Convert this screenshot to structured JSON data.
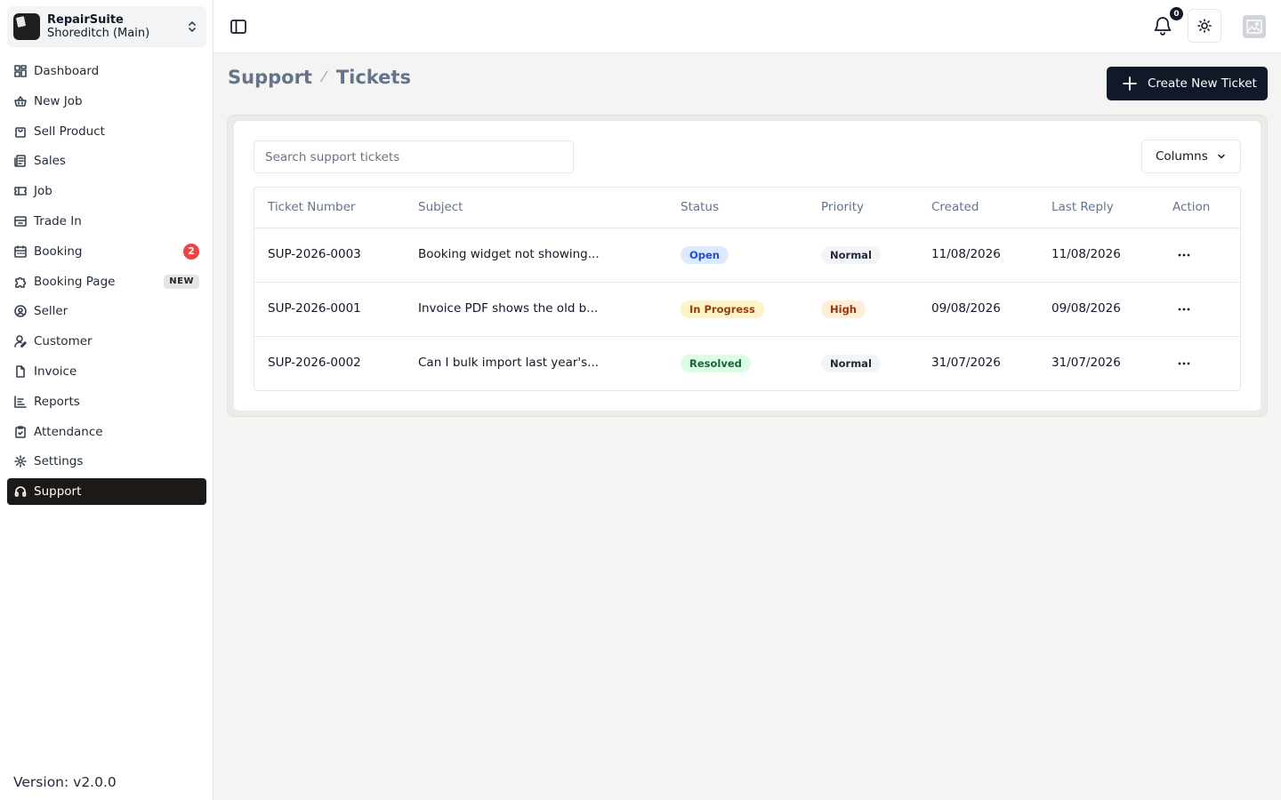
{
  "org": {
    "name": "RepairSuite",
    "branch": "Shoreditch (Main)"
  },
  "nav": [
    {
      "label": "Dashboard",
      "icon": "dashboard-icon"
    },
    {
      "label": "New Job",
      "icon": "basket-icon"
    },
    {
      "label": "Sell Product",
      "icon": "bag-icon"
    },
    {
      "label": "Sales",
      "icon": "receipt-icon"
    },
    {
      "label": "Job",
      "icon": "ticket-icon"
    },
    {
      "label": "Trade In",
      "icon": "archive-icon"
    },
    {
      "label": "Booking",
      "icon": "calendar-icon",
      "badge": "2"
    },
    {
      "label": "Booking Page",
      "icon": "puzzle-icon",
      "tag": "NEW"
    },
    {
      "label": "Seller",
      "icon": "at-icon"
    },
    {
      "label": "Customer",
      "icon": "user-pen-icon"
    },
    {
      "label": "Invoice",
      "icon": "file-icon"
    },
    {
      "label": "Reports",
      "icon": "chart-icon"
    },
    {
      "label": "Attendance",
      "icon": "clipboard-check-icon"
    },
    {
      "label": "Settings",
      "icon": "gear-icon"
    },
    {
      "label": "Support",
      "icon": "headphones-icon",
      "active": true
    }
  ],
  "version": "Version: v2.0.0",
  "topbar": {
    "notification_count": "0"
  },
  "breadcrumb": {
    "parent": "Support",
    "current": "Tickets"
  },
  "create_button": "Create New Ticket",
  "search": {
    "placeholder": "Search support tickets"
  },
  "columns_button": "Columns",
  "table": {
    "headers": [
      "Ticket Number",
      "Subject",
      "Status",
      "Priority",
      "Created",
      "Last Reply",
      "Action"
    ],
    "rows": [
      {
        "number": "SUP-2026-0003",
        "subject": "Booking widget not showing...",
        "status": "Open",
        "priority": "Normal",
        "created": "11/08/2026",
        "last_reply": "11/08/2026"
      },
      {
        "number": "SUP-2026-0001",
        "subject": "Invoice PDF shows the old b...",
        "status": "In Progress",
        "priority": "High",
        "created": "09/08/2026",
        "last_reply": "09/08/2026"
      },
      {
        "number": "SUP-2026-0002",
        "subject": "Can I bulk import last year's...",
        "status": "Resolved",
        "priority": "Normal",
        "created": "31/07/2026",
        "last_reply": "31/07/2026"
      }
    ]
  },
  "colors": {
    "accent": "#111827",
    "active_nav": "#1c1917",
    "badge": "#ef4444",
    "status_open_bg": "#dbeafe",
    "status_open_fg": "#1d4ed8",
    "status_progress_bg": "#fef3c7",
    "status_progress_fg": "#92400e",
    "status_resolved_bg": "#dcfce7",
    "status_resolved_fg": "#166534",
    "priority_high_bg": "#ffedd5",
    "priority_high_fg": "#9a3412",
    "priority_normal_bg": "#f3f4f6",
    "priority_normal_fg": "#1f2937"
  }
}
